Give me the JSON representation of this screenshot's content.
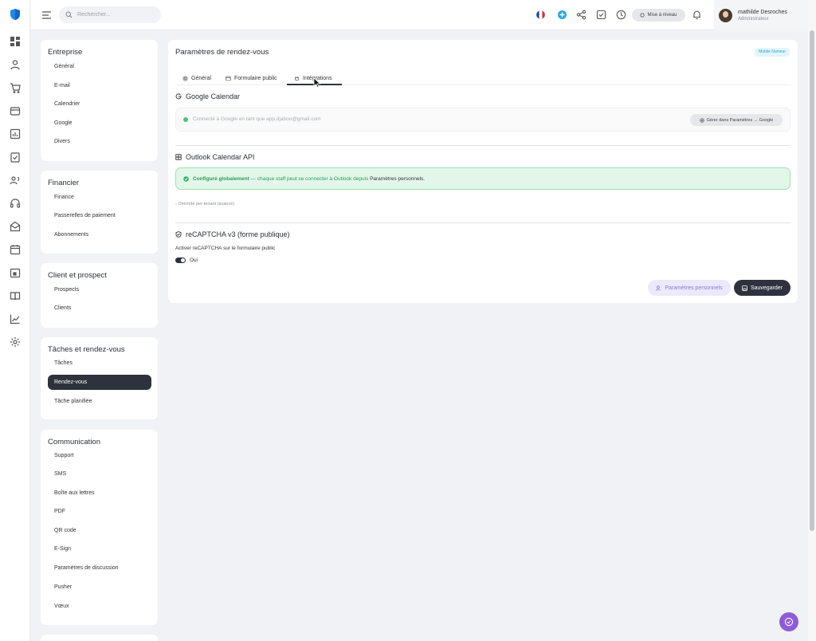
{
  "topbar": {
    "search_placeholder": "Rechercher...",
    "upgrade_label": "Mise à niveau",
    "user": {
      "name": "mathilde Desroches",
      "role": "Administrateur"
    }
  },
  "sidebar": [
    {
      "title": "Entreprise",
      "items": [
        "Général",
        "E-mail",
        "Calendrier",
        "Google",
        "Divers"
      ]
    },
    {
      "title": "Financier",
      "items": [
        "Finance",
        "Passerelles de paiement",
        "Abonnements"
      ]
    },
    {
      "title": "Client et prospect",
      "items": [
        "Prospects",
        "Clients"
      ]
    },
    {
      "title": "Tâches et rendez-vous",
      "items": [
        "Tâches",
        "Rendez-vous",
        "Tâche planifiée"
      ],
      "active": "Rendez-vous"
    },
    {
      "title": "Communication",
      "items": [
        "Support",
        "SMS",
        "Boîte aux lettres",
        "PDF",
        "QR code",
        "E-Sign",
        "Paramètres de discussion",
        "Pusher",
        "Vœux"
      ]
    }
  ],
  "panel": {
    "title": "Paramètres de rendez-vous",
    "badge": "Mobile Numeur",
    "tabs": [
      "Général",
      "Formulaire public",
      "Intégrations"
    ],
    "active_tab": "Intégrations",
    "google": {
      "title": "Google Calendar",
      "status": "Connecté à Google en tant que app.djaboo@gmail.com",
      "manage_button": "Gérer dans Paramètres → Google"
    },
    "outlook": {
      "title": "Outlook Calendar API",
      "status_bold": "Configuré globalement",
      "status_text": " — chaque staff peut se connecter à Outlook depuis ",
      "status_link": "Paramètres personnels.",
      "override": "› Override per-tenant (avancé)"
    },
    "recaptcha": {
      "title": "reCAPTCHA v3 (forme publique)",
      "label": "Activer reCAPTCHA sur le formulaire public",
      "toggle_label": "Oui"
    },
    "buttons": {
      "personal": "Paramètres personnels",
      "save": "Sauvegarder"
    }
  },
  "colors": {
    "accent_dark": "#2d323c",
    "success": "#4cc27b",
    "purple": "#8e5bd8",
    "brand_blue": "#1e88e5"
  }
}
